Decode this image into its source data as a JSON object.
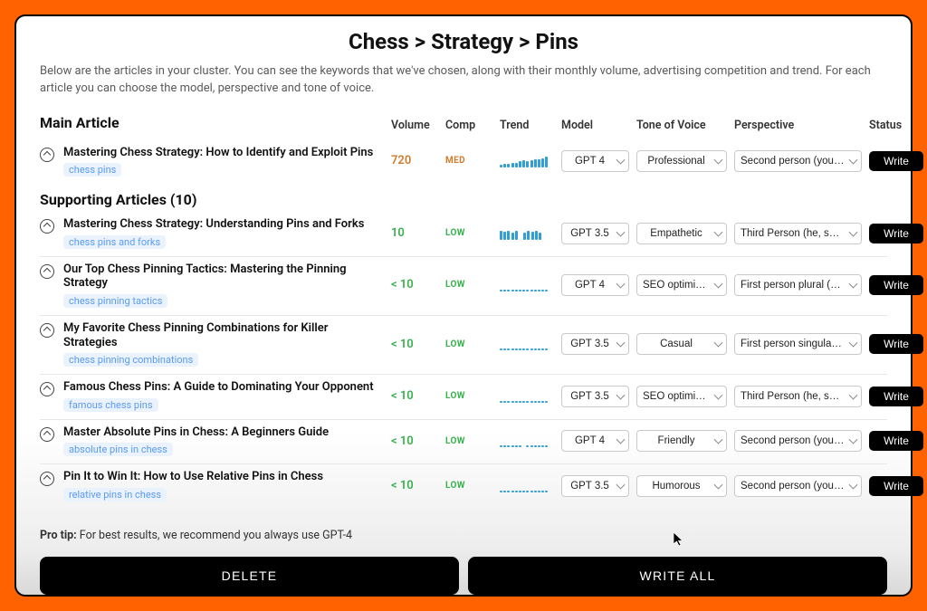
{
  "breadcrumb": "Chess > Strategy > Pins",
  "intro": "Below are the articles in your cluster. You can see the keywords that we've chosen, along with their monthly volume, advertising competition and trend. For each article you can choose the model, perspective and tone of voice.",
  "columns": {
    "main_article": "Main Article",
    "volume": "Volume",
    "comp": "Comp",
    "trend": "Trend",
    "model": "Model",
    "tone": "Tone of Voice",
    "perspective": "Perspective",
    "status": "Status"
  },
  "labels": {
    "write": "Write",
    "delete": "DELETE",
    "write_all": "WRITE ALL"
  },
  "supporting_header": "Supporting Articles (10)",
  "protip_label": "Pro tip:",
  "protip_text": " For best results, we recommend you always use GPT-4",
  "main": {
    "title": "Mastering Chess Strategy: How to Identify and Exploit Pins",
    "keyword": "chess pins",
    "volume": "720",
    "comp": "MED",
    "trend_bars": [
      3,
      4,
      4,
      5,
      5,
      7,
      8,
      7,
      8,
      9,
      9,
      10,
      12
    ],
    "model": "GPT 4",
    "tone": "Professional",
    "perspective": "Second person (you, your)"
  },
  "supporting": [
    {
      "title": "Mastering Chess Strategy: Understanding Pins and Forks",
      "keyword": "chess pins and forks",
      "volume": "10",
      "vol_class": "vol-10",
      "comp": "LOW",
      "trend": "two-blocks",
      "model": "GPT 3.5",
      "tone": "Empathetic",
      "perspective": "Third Person (he, she, it, they)"
    },
    {
      "title": "Our Top Chess Pinning Tactics: Mastering the Pinning Strategy",
      "keyword": "chess pinning tactics",
      "volume": "< 10",
      "vol_class": "vol-lt10",
      "comp": "LOW",
      "trend": "dotted",
      "model": "GPT 4",
      "tone": "SEO optimized (recommended)",
      "perspective": "First person plural (we, us, our)"
    },
    {
      "title": "My Favorite Chess Pinning Combinations for Killer Strategies",
      "keyword": "chess pinning combinations",
      "volume": "< 10",
      "vol_class": "vol-lt10",
      "comp": "LOW",
      "trend": "dotted",
      "model": "GPT 3.5",
      "tone": "Casual",
      "perspective": "First person singular (I, me, my)"
    },
    {
      "title": "Famous Chess Pins: A Guide to Dominating Your Opponent",
      "keyword": "famous chess pins",
      "volume": "< 10",
      "vol_class": "vol-lt10",
      "comp": "LOW",
      "trend": "dotted",
      "model": "GPT 3.5",
      "tone": "SEO optimized (recommended)",
      "perspective": "Third Person (he, she, it, they)"
    },
    {
      "title": "Master Absolute Pins in Chess: A Beginners Guide",
      "keyword": "absolute pins in chess",
      "volume": "< 10",
      "vol_class": "vol-lt10",
      "comp": "LOW",
      "trend": "dotted-gap",
      "model": "GPT 4",
      "tone": "Friendly",
      "perspective": "Second person (you, your)"
    },
    {
      "title": "Pin It to Win It: How to Use Relative Pins in Chess",
      "keyword": "relative pins in chess",
      "volume": "< 10",
      "vol_class": "vol-lt10",
      "comp": "LOW",
      "trend": "dotted",
      "model": "GPT 3.5",
      "tone": "Humorous",
      "perspective": "Second person (you, your)"
    }
  ]
}
